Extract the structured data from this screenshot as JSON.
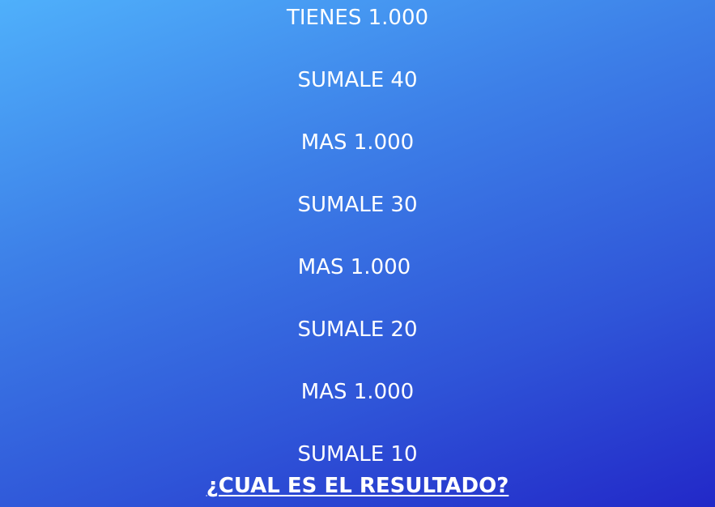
{
  "steps": [
    "TIENES 1.000",
    "SUMALE 40",
    "MAS 1.000",
    "SUMALE 30",
    "MAS 1.000",
    "SUMALE 20",
    "MAS 1.000",
    "SUMALE 10"
  ],
  "question": "¿CUAL ES EL RESULTADO?",
  "colors": {
    "text": "#ffffff",
    "gradient_start": "#4fb0fb",
    "gradient_end": "#2228c8"
  }
}
